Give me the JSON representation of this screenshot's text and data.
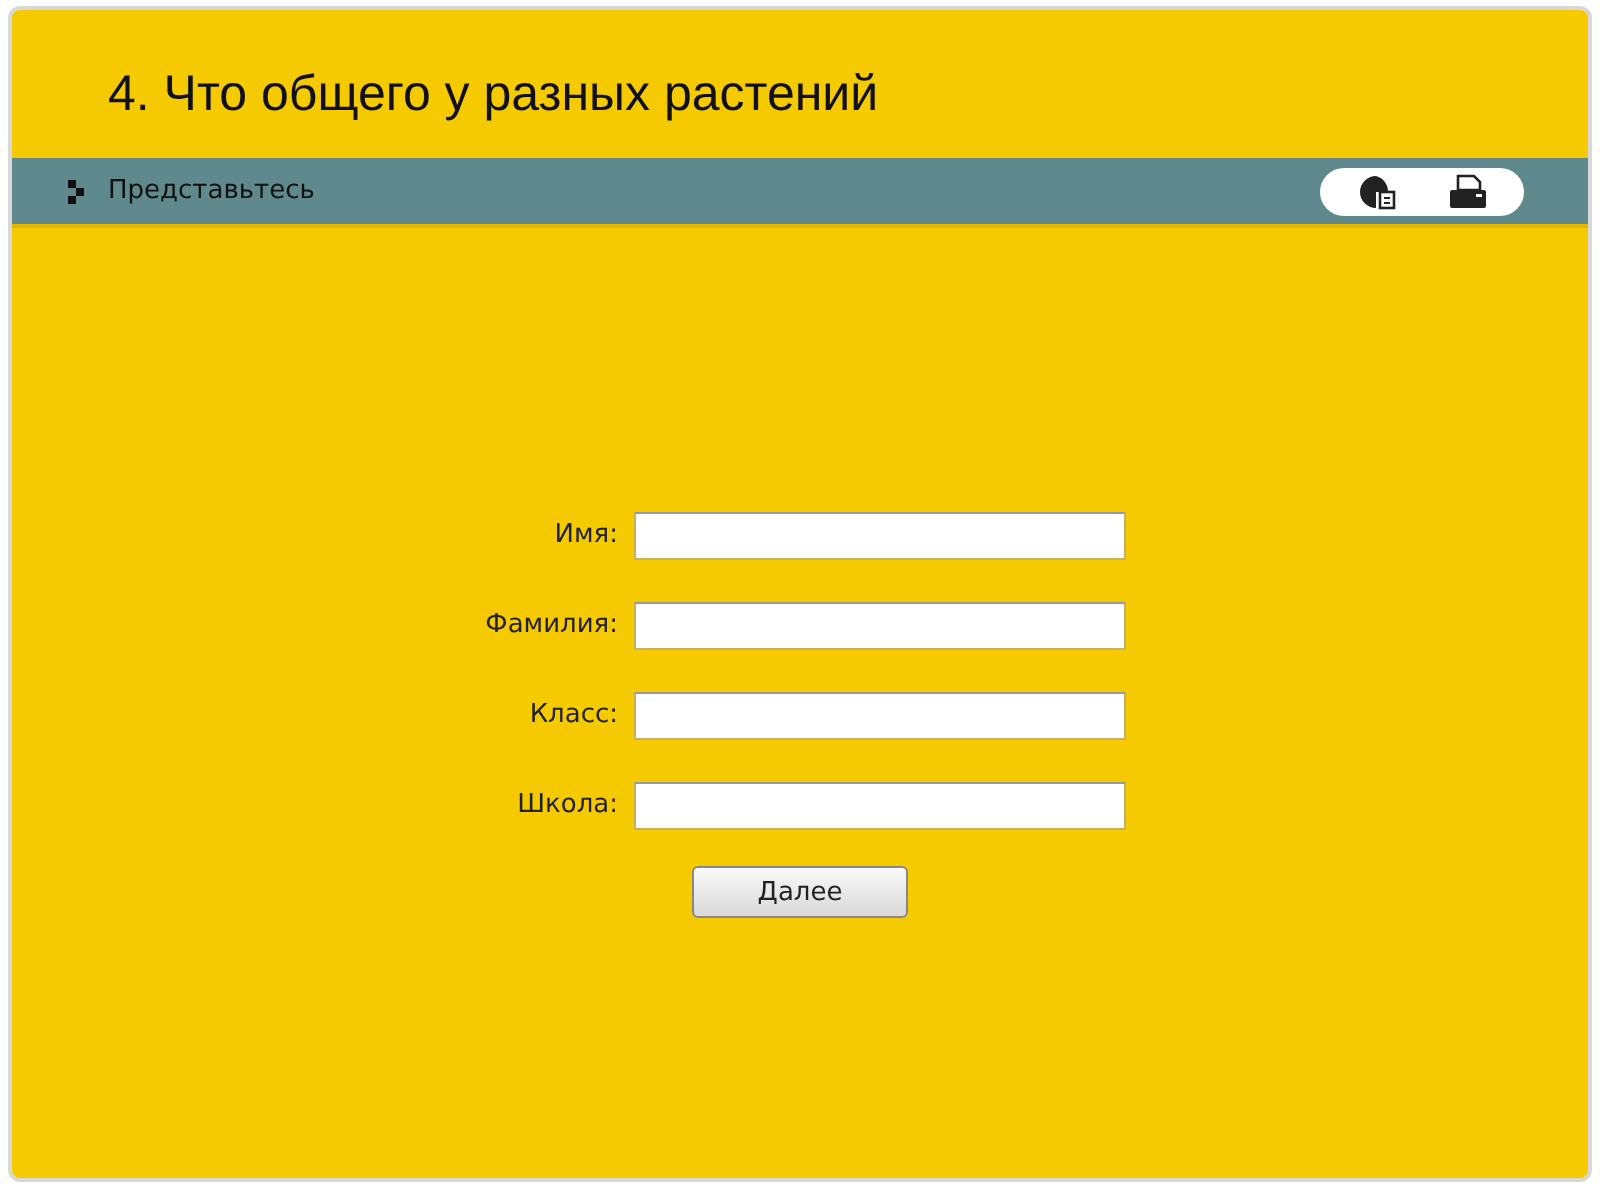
{
  "title": "4. Что общего у разных растений",
  "toolbar": {
    "section": "Представьтесь"
  },
  "form": {
    "fields": [
      {
        "label": "Имя:"
      },
      {
        "label": "Фамилия:"
      },
      {
        "label": "Класс:"
      },
      {
        "label": "Школа:"
      }
    ],
    "button": "Далее"
  }
}
